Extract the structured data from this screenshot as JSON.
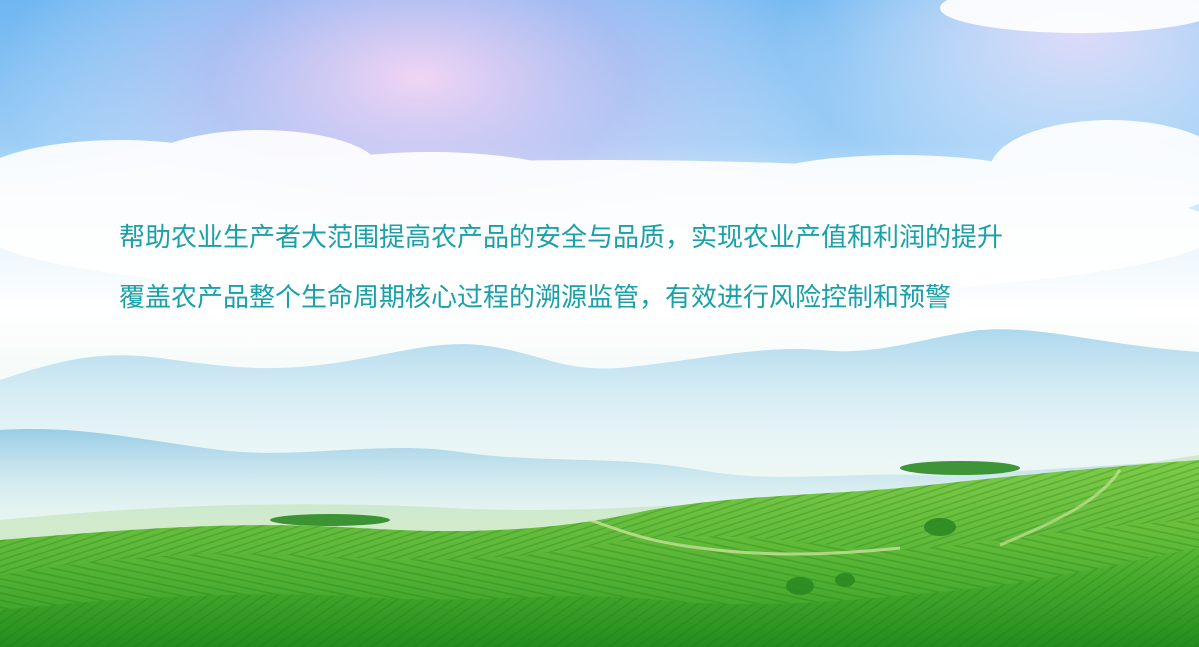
{
  "banner": {
    "lines": [
      "帮助农业生产者大范围提高农产品的安全与品质，实现农业产值和利润的提升",
      "覆盖农产品整个生命周期核心过程的溯源监管，有效进行风险控制和预警"
    ],
    "text_color": "#1aa0a8"
  },
  "scene": {
    "sky_top_color": "#6fb8f0",
    "sky_bottom_color": "#ffffff",
    "mountain_color": "#8ec9e6",
    "field_color": "#3fae2e"
  }
}
